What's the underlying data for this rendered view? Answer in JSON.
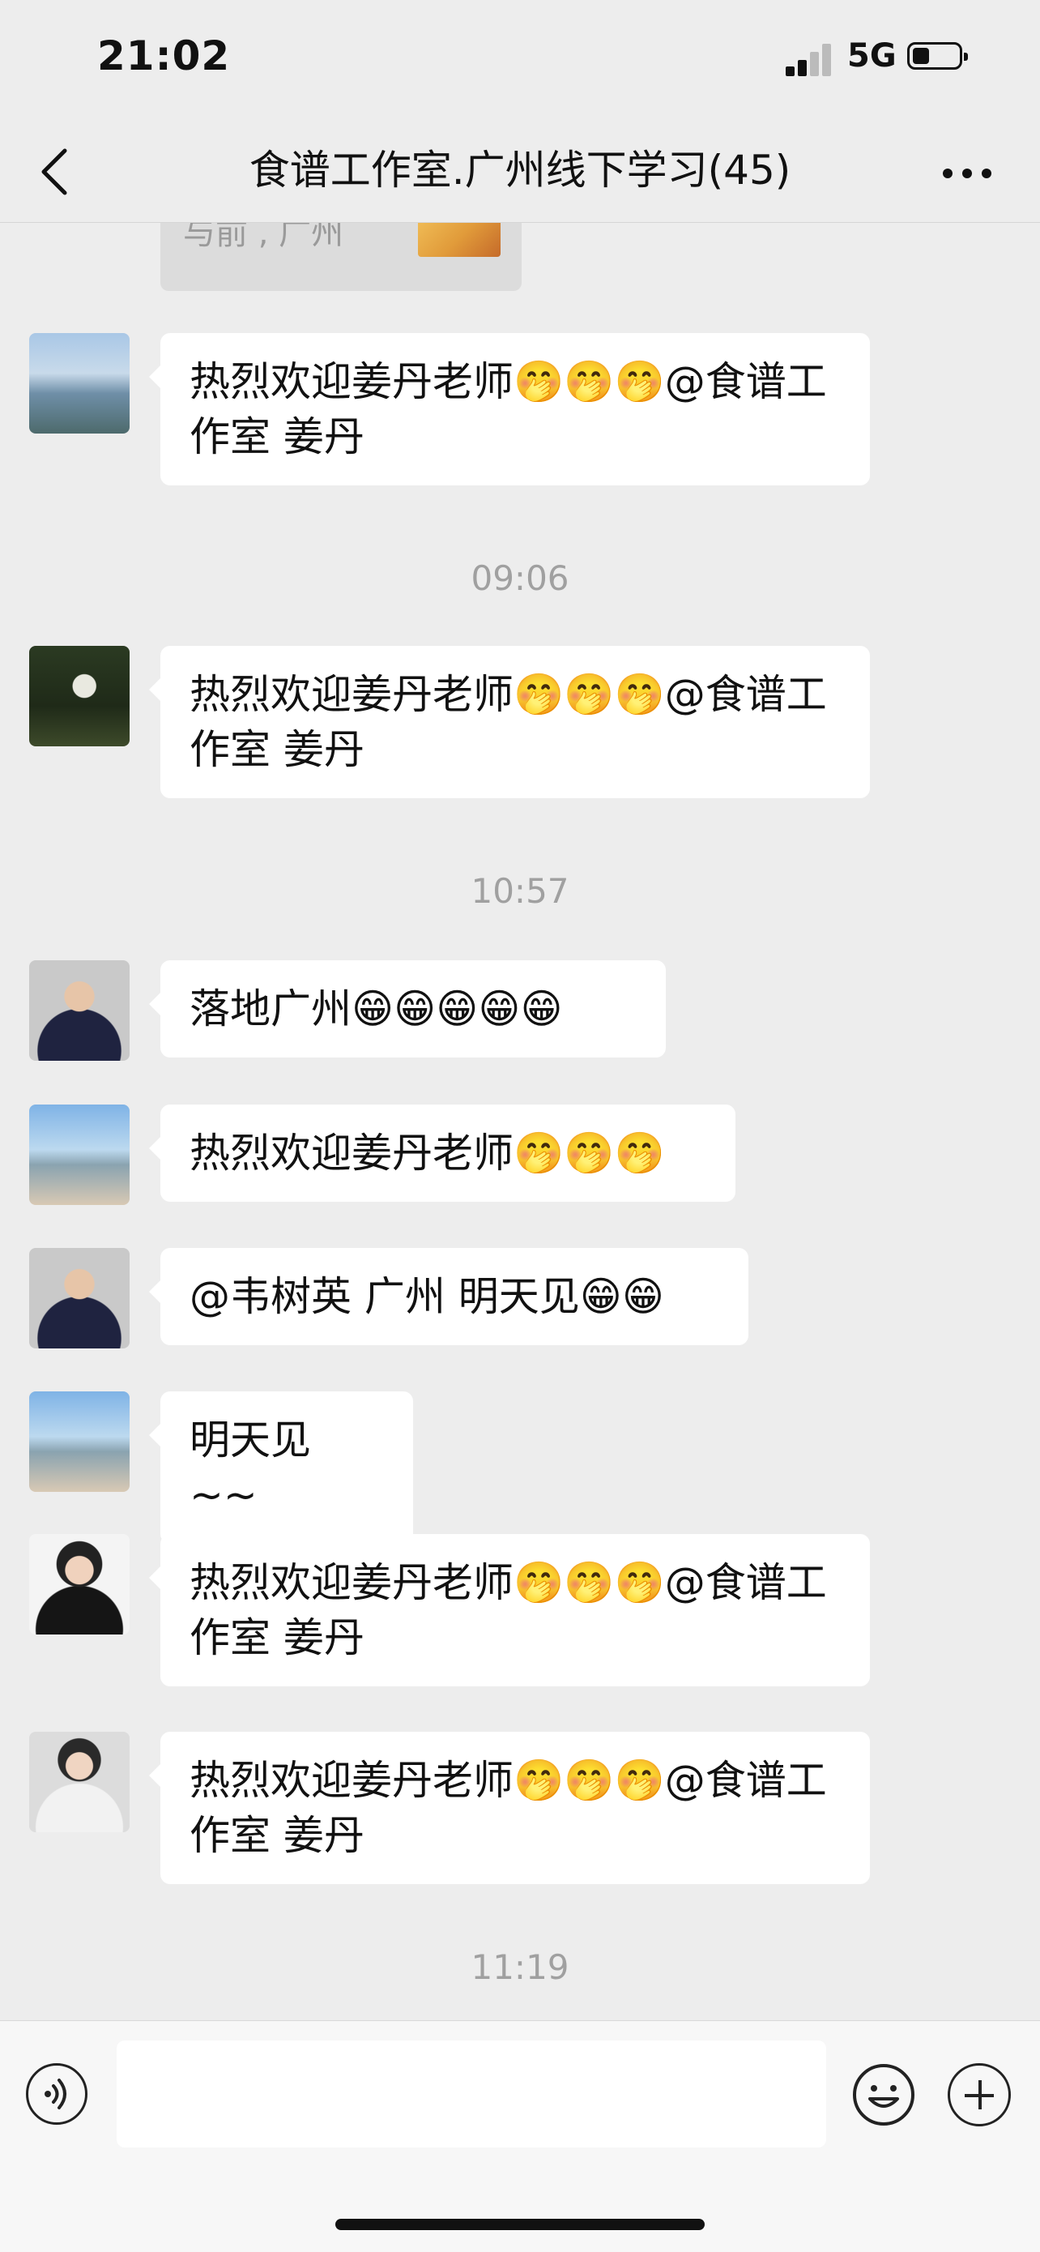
{
  "status_bar": {
    "time": "21:02",
    "network": "5G"
  },
  "nav": {
    "title": "食谱工作室.广州线下学习(45)"
  },
  "partial_message": {
    "text": "与前 , 广州"
  },
  "messages": [
    {
      "text": "热烈欢迎姜丹老师🤭🤭🤭@食谱工作室 姜丹",
      "avatar": "avatar-sea"
    },
    {
      "text": "热烈欢迎姜丹老师🤭🤭🤭@食谱工作室 姜丹",
      "avatar": "avatar-buddha"
    },
    {
      "text": "落地广州😁😁😁😁😁",
      "avatar": "avatar-woman-glasses"
    },
    {
      "text": "热烈欢迎姜丹老师🤭🤭🤭",
      "avatar": "avatar-beach"
    },
    {
      "text": "@韦树英 广州 明天见😁😁",
      "avatar": "avatar-woman-glasses"
    },
    {
      "text": "明天见 ~~",
      "avatar": "avatar-beach"
    },
    {
      "text": "热烈欢迎姜丹老师🤭🤭🤭@食谱工作室 姜丹",
      "avatar": "avatar-woman-black"
    },
    {
      "text": "热烈欢迎姜丹老师🤭🤭🤭@食谱工作室 姜丹",
      "avatar": "avatar-woman-white"
    }
  ],
  "timestamps": [
    "09:06",
    "10:57",
    "11:19"
  ],
  "input": {
    "value": "",
    "placeholder": ""
  },
  "icons": {
    "back": "chevron-left-icon",
    "more": "more-dots-icon",
    "voice": "voice-icon",
    "emoji": "emoji-icon",
    "plus": "plus-icon"
  }
}
